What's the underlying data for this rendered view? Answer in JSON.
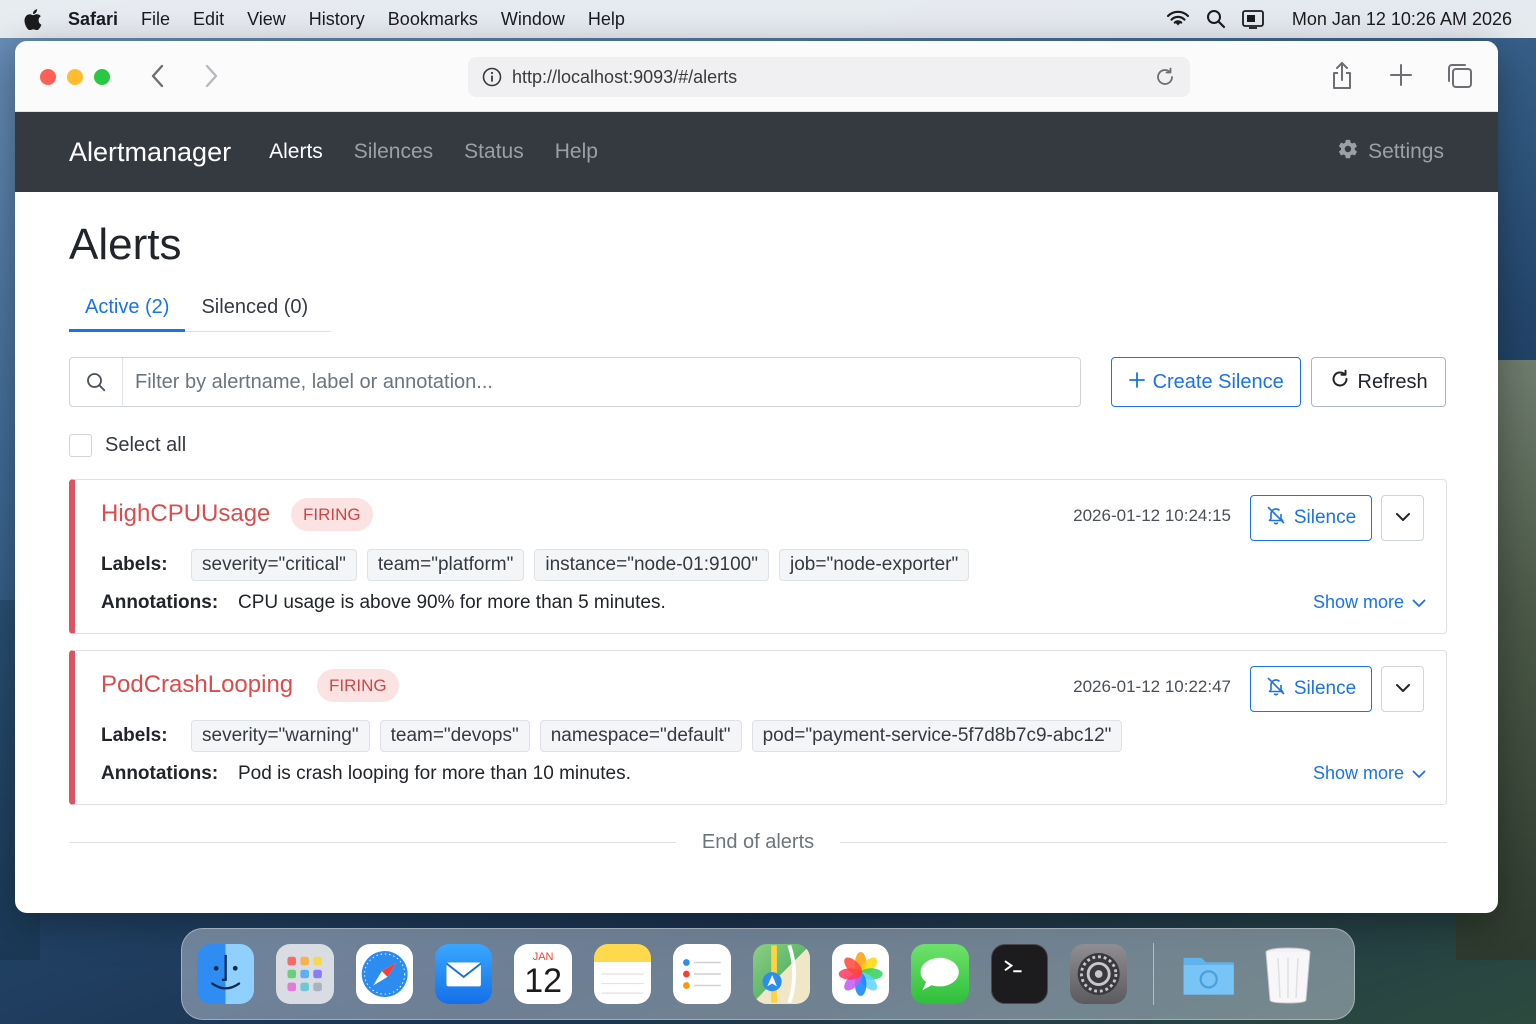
{
  "menubar": {
    "app_name": "Safari",
    "items": [
      "File",
      "Edit",
      "View",
      "History",
      "Bookmarks",
      "Window",
      "Help"
    ],
    "clock": "Mon Jan 12 10:26 AM 2026"
  },
  "browser": {
    "url": "http://localhost:9093/#/alerts"
  },
  "navbar": {
    "brand": "Alertmanager",
    "links": [
      "Alerts",
      "Silences",
      "Status",
      "Help"
    ],
    "active_link": "Alerts",
    "settings_label": "Settings"
  },
  "page": {
    "title": "Alerts",
    "tabs": [
      {
        "label": "Active (2)",
        "active": true
      },
      {
        "label": "Silenced (0)",
        "active": false
      }
    ],
    "filter_placeholder": "Filter by alertname, label or annotation...",
    "create_silence_label": "Create Silence",
    "refresh_label": "Refresh",
    "select_all_label": "Select all",
    "labels_title": "Labels:",
    "annotations_title": "Annotations:",
    "silence_label": "Silence",
    "show_more_label": "Show more",
    "end_text": "End of alerts"
  },
  "alerts": [
    {
      "name": "HighCPUUsage",
      "status": "FIRING",
      "time": "2026-01-12 10:24:15",
      "labels": [
        "severity=\"critical\"",
        "team=\"platform\"",
        "instance=\"node-01:9100\"",
        "job=\"node-exporter\""
      ],
      "annotation": "CPU usage is above 90% for more than 5 minutes."
    },
    {
      "name": "PodCrashLooping",
      "status": "FIRING",
      "time": "2026-01-12 10:22:47",
      "labels": [
        "severity=\"warning\"",
        "team=\"devops\"",
        "namespace=\"default\"",
        "pod=\"payment-service-5f7d8b7c9-abc12\""
      ],
      "annotation": "Pod is crash looping for more than 10 minutes."
    }
  ],
  "dock": {
    "apps": [
      "finder-icon",
      "launchpad-icon",
      "safari-icon",
      "mail-icon",
      "calendar-icon",
      "notes-icon",
      "reminders-icon",
      "maps-icon",
      "photos-icon",
      "messages-icon",
      "terminal-icon",
      "system-settings-icon",
      "downloads-folder-icon",
      "trash-icon"
    ],
    "calendar_month": "JAN",
    "calendar_day": "12"
  },
  "colors": {
    "accent": "#1a73e8",
    "firing": "#dc4c4c",
    "navbar_bg": "#343a40"
  }
}
